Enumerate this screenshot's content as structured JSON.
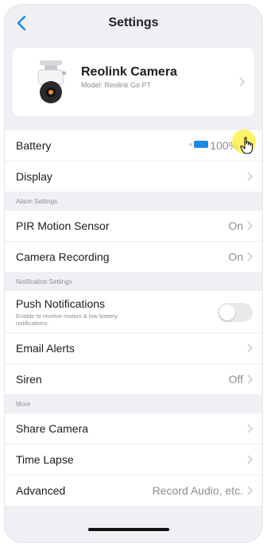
{
  "nav": {
    "title": "Settings"
  },
  "camera": {
    "name": "Reolink Camera",
    "model": "Model: Reolink Go PT"
  },
  "battery": {
    "label": "Battery",
    "value": "100%",
    "level": 1.0,
    "color": "#1e88e5"
  },
  "display": {
    "label": "Display"
  },
  "alarm": {
    "header": "Alarm Settings",
    "pir": {
      "label": "PIR Motion Sensor",
      "value": "On"
    },
    "recording": {
      "label": "Camera Recording",
      "value": "On"
    }
  },
  "notifications": {
    "header": "Notification Settings",
    "push": {
      "label": "Push Notifications",
      "sub": "Enable to receive motion & low battery notifications.",
      "enabled": false
    },
    "email": {
      "label": "Email Alerts"
    },
    "siren": {
      "label": "Siren",
      "value": "Off"
    }
  },
  "more": {
    "header": "More",
    "share": {
      "label": "Share Camera"
    },
    "timelapse": {
      "label": "Time Lapse"
    },
    "advanced": {
      "label": "Advanced",
      "value": "Record Audio, etc."
    }
  },
  "colors": {
    "accent": "#1e88e5",
    "background": "#efeff4",
    "cursor_highlight": "#ffee32"
  },
  "icons": [
    "back-chevron-icon",
    "camera-icon",
    "chevron-right-icon",
    "battery-icon",
    "hand-cursor-icon"
  ]
}
